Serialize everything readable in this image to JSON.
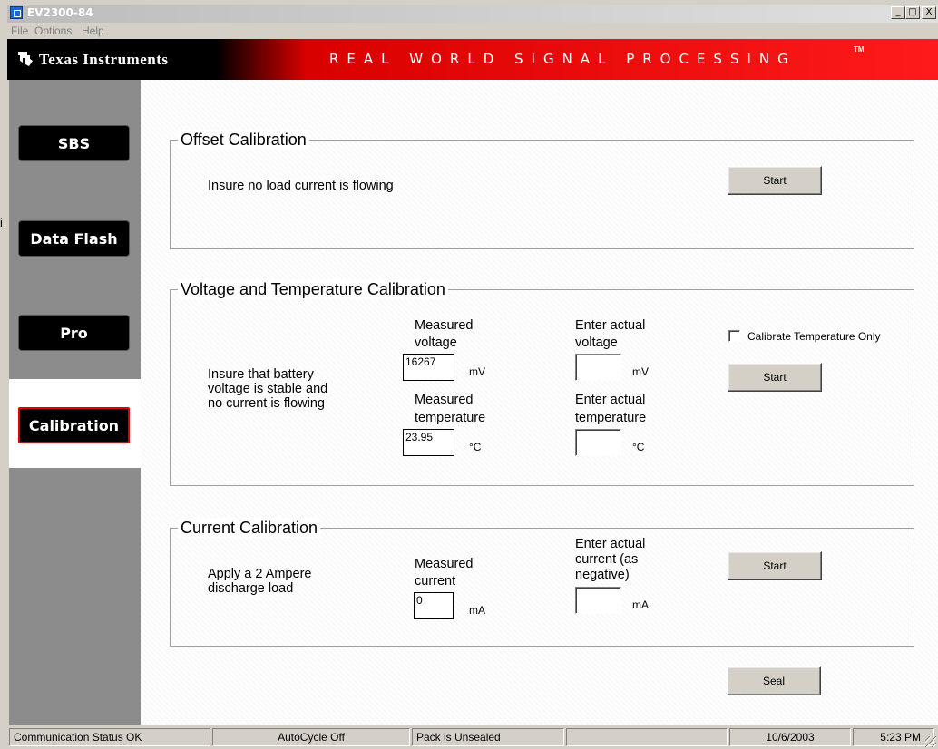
{
  "window": {
    "title": "EV2300-84",
    "minimize": "_",
    "maximize": "□",
    "close": "X"
  },
  "menu": [
    "File",
    "Options",
    "Help"
  ],
  "banner": {
    "company": "Texas Instruments",
    "tagline": "REAL WORLD SIGNAL PROCESSING",
    "tm": "TM"
  },
  "sidebar": {
    "items": [
      "SBS",
      "Data Flash",
      "Pro",
      "Calibration"
    ],
    "active": "Calibration"
  },
  "offset": {
    "title": "Offset Calibration",
    "instruction": "Insure no load current is flowing",
    "start": "Start"
  },
  "vt": {
    "title": "Voltage and Temperature Calibration",
    "instruction_lines": [
      "Insure that battery",
      "voltage is stable and",
      "no current is flowing"
    ],
    "measured_voltage_label": [
      "Measured",
      "voltage"
    ],
    "measured_voltage": "16267",
    "voltage_unit": "mV",
    "actual_voltage_label": [
      "Enter actual",
      "voltage"
    ],
    "actual_voltage": "",
    "measured_temp_label": [
      "Measured",
      "temperature"
    ],
    "measured_temp": "23.95",
    "temp_unit": "°C",
    "actual_temp_label": [
      "Enter actual",
      "temperature"
    ],
    "actual_temp": "",
    "temp_only_label": "Calibrate Temperature Only",
    "temp_only_checked": false,
    "start": "Start"
  },
  "current": {
    "title": "Current Calibration",
    "instruction_lines": [
      "Apply a 2 Ampere",
      "discharge load"
    ],
    "measured_label": [
      "Measured",
      "current"
    ],
    "measured": "0",
    "unit": "mA",
    "actual_label": [
      "Enter actual",
      "current (as",
      "negative)"
    ],
    "actual": "",
    "start": "Start"
  },
  "seal": "Seal",
  "status": {
    "comm": "Communication Status OK",
    "autocycle": "AutoCycle Off",
    "pack": "Pack is Unsealed",
    "empty": "",
    "date": "10/6/2003",
    "time": "5:23 PM"
  }
}
